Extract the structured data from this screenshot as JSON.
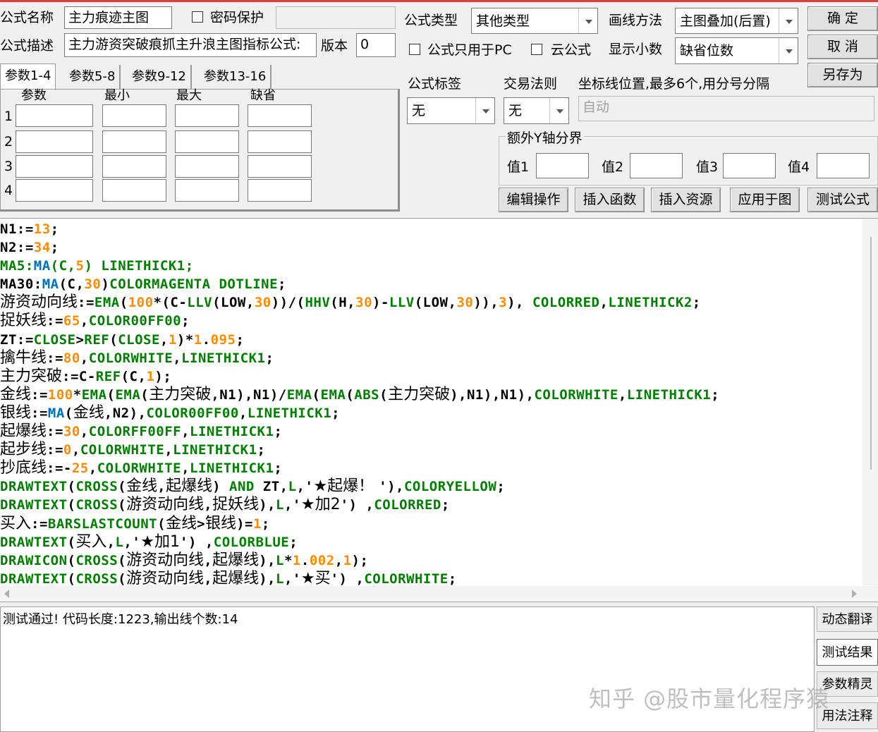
{
  "header": {
    "formula_name_label": "公式名称",
    "formula_name_value": "主力痕迹主图",
    "password_label": "密码保护",
    "formula_desc_label": "公式描述",
    "formula_desc_value": "主力游资突破痕抓主升浪主图指标公式:",
    "version_label": "版本",
    "version_value": "0",
    "formula_type_label": "公式类型",
    "formula_type_value": "其他类型",
    "draw_method_label": "画线方法",
    "draw_method_value": "主图叠加(后置)",
    "pc_only_label": "公式只用于PC",
    "cloud_label": "云公式",
    "show_decimal_label": "显示小数",
    "show_decimal_value": "缺省位数"
  },
  "buttons": {
    "ok": "确 定",
    "cancel": "取 消",
    "save_as": "另存为"
  },
  "tabs": [
    "参数1-4",
    "参数5-8",
    "参数9-12",
    "参数13-16"
  ],
  "params": {
    "col_param": "参数",
    "col_min": "最小",
    "col_max": "最大",
    "col_default": "缺省",
    "rows": [
      "1",
      "2",
      "3",
      "4"
    ]
  },
  "options": {
    "tag_label": "公式标签",
    "tag_value": "无",
    "trade_rule_label": "交易法则",
    "trade_rule_value": "无",
    "axis_label": "坐标线位置,最多6个,用分号分隔",
    "axis_placeholder": "自动",
    "extra_y_label": "额外Y轴分界",
    "val1": "值1",
    "val2": "值2",
    "val3": "值3",
    "val4": "值4"
  },
  "actions": {
    "edit": "编辑操作",
    "insert_func": "插入函数",
    "insert_res": "插入资源",
    "apply": "应用于图",
    "test": "测试公式"
  },
  "colors": {
    "keyword": "#008000",
    "function": "#0070c0",
    "number": "#ff8c00",
    "title_bar": "#d9403a"
  },
  "code_lines": [
    [
      [
        "k",
        "N1:="
      ],
      [
        "o",
        "13"
      ],
      [
        "k",
        ";"
      ]
    ],
    [
      [
        "k",
        "N2:="
      ],
      [
        "o",
        "34"
      ],
      [
        "k",
        ";"
      ]
    ],
    [
      [
        "g",
        "MA5:"
      ],
      [
        "b",
        "MA"
      ],
      [
        "g",
        "(C,"
      ],
      [
        "o",
        "5"
      ],
      [
        "g",
        ") LINETHICK1;"
      ]
    ],
    [
      [
        "k",
        "MA30:"
      ],
      [
        "b",
        "MA"
      ],
      [
        "k",
        "(C,"
      ],
      [
        "o",
        "30"
      ],
      [
        "k",
        ")"
      ],
      [
        "g",
        "COLORMAGENTA DOTLINE"
      ],
      [
        "k",
        ";"
      ]
    ],
    [
      [
        "cn",
        "游资动向线"
      ],
      [
        "k",
        ":="
      ],
      [
        "g",
        "EMA"
      ],
      [
        "k",
        "("
      ],
      [
        "o",
        "100"
      ],
      [
        "k",
        "*(C-"
      ],
      [
        "g",
        "LLV"
      ],
      [
        "k",
        "(LOW,"
      ],
      [
        "o",
        "30"
      ],
      [
        "k",
        "))/("
      ],
      [
        "g",
        "HHV"
      ],
      [
        "k",
        "(H,"
      ],
      [
        "o",
        "30"
      ],
      [
        "k",
        ")-"
      ],
      [
        "g",
        "LLV"
      ],
      [
        "k",
        "(LOW,"
      ],
      [
        "o",
        "30"
      ],
      [
        "k",
        ")),"
      ],
      [
        "o",
        "3"
      ],
      [
        "k",
        "), "
      ],
      [
        "g",
        "COLORRED"
      ],
      [
        "k",
        ","
      ],
      [
        "g",
        "LINETHICK2"
      ],
      [
        "k",
        ";"
      ]
    ],
    [
      [
        "cn",
        "捉妖线"
      ],
      [
        "k",
        ":="
      ],
      [
        "o",
        "65"
      ],
      [
        "k",
        ","
      ],
      [
        "g",
        "COLOR00FF00"
      ],
      [
        "k",
        ";"
      ]
    ],
    [
      [
        "k",
        "ZT:="
      ],
      [
        "g",
        "CLOSE"
      ],
      [
        "k",
        ">"
      ],
      [
        "g",
        "REF"
      ],
      [
        "k",
        "("
      ],
      [
        "g",
        "CLOSE"
      ],
      [
        "k",
        ","
      ],
      [
        "o",
        "1"
      ],
      [
        "k",
        ")*"
      ],
      [
        "o",
        "1"
      ],
      [
        "k",
        "."
      ],
      [
        "o",
        "095"
      ],
      [
        "k",
        ";"
      ]
    ],
    [
      [
        "cn",
        "擒牛线"
      ],
      [
        "k",
        ":="
      ],
      [
        "o",
        "80"
      ],
      [
        "k",
        ","
      ],
      [
        "g",
        "COLORWHITE"
      ],
      [
        "k",
        ","
      ],
      [
        "g",
        "LINETHICK1"
      ],
      [
        "k",
        ";"
      ]
    ],
    [
      [
        "cn",
        "主力突破"
      ],
      [
        "k",
        ":=C-"
      ],
      [
        "g",
        "REF"
      ],
      [
        "k",
        "(C,"
      ],
      [
        "o",
        "1"
      ],
      [
        "k",
        ");"
      ]
    ],
    [
      [
        "cn",
        "金线"
      ],
      [
        "k",
        ":="
      ],
      [
        "o",
        "100"
      ],
      [
        "k",
        "*"
      ],
      [
        "g",
        "EMA"
      ],
      [
        "k",
        "("
      ],
      [
        "g",
        "EMA"
      ],
      [
        "k",
        "("
      ],
      [
        "cn",
        "主力突破"
      ],
      [
        "k",
        ",N1),N1)/"
      ],
      [
        "g",
        "EMA"
      ],
      [
        "k",
        "("
      ],
      [
        "g",
        "EMA"
      ],
      [
        "k",
        "("
      ],
      [
        "g",
        "ABS"
      ],
      [
        "k",
        "("
      ],
      [
        "cn",
        "主力突破"
      ],
      [
        "k",
        "),N1),N1),"
      ],
      [
        "g",
        "COLORWHITE"
      ],
      [
        "k",
        ","
      ],
      [
        "g",
        "LINETHICK1"
      ],
      [
        "k",
        ";"
      ]
    ],
    [
      [
        "cn",
        "银线"
      ],
      [
        "k",
        ":="
      ],
      [
        "b",
        "MA"
      ],
      [
        "k",
        "("
      ],
      [
        "cn",
        "金线"
      ],
      [
        "k",
        ",N2),"
      ],
      [
        "g",
        "COLOR00FF00"
      ],
      [
        "k",
        ","
      ],
      [
        "g",
        "LINETHICK1"
      ],
      [
        "k",
        ";"
      ]
    ],
    [
      [
        "cn",
        "起爆线"
      ],
      [
        "k",
        ":="
      ],
      [
        "o",
        "30"
      ],
      [
        "k",
        ","
      ],
      [
        "g",
        "COLORFF00FF"
      ],
      [
        "k",
        ","
      ],
      [
        "g",
        "LINETHICK1"
      ],
      [
        "k",
        ";"
      ]
    ],
    [
      [
        "cn",
        "起步线"
      ],
      [
        "k",
        ":="
      ],
      [
        "o",
        "0"
      ],
      [
        "k",
        ","
      ],
      [
        "g",
        "COLORWHITE"
      ],
      [
        "k",
        ","
      ],
      [
        "g",
        "LINETHICK1"
      ],
      [
        "k",
        ";"
      ]
    ],
    [
      [
        "cn",
        "抄底线"
      ],
      [
        "k",
        ":=-"
      ],
      [
        "o",
        "25"
      ],
      [
        "k",
        ","
      ],
      [
        "g",
        "COLORWHITE"
      ],
      [
        "k",
        ","
      ],
      [
        "g",
        "LINETHICK1"
      ],
      [
        "k",
        ";"
      ]
    ],
    [
      [
        "g",
        "DRAWTEXT"
      ],
      [
        "k",
        "("
      ],
      [
        "g",
        "CROSS"
      ],
      [
        "k",
        "("
      ],
      [
        "cn",
        "金线"
      ],
      [
        "k",
        ","
      ],
      [
        "cn",
        "起爆线"
      ],
      [
        "k",
        ") "
      ],
      [
        "g",
        "AND"
      ],
      [
        "k",
        " ZT,"
      ],
      [
        "g",
        "L"
      ],
      [
        "k",
        ",'"
      ],
      [
        "cn",
        "★起爆！ "
      ],
      [
        "k",
        "'),"
      ],
      [
        "g",
        "COLORYELLOW"
      ],
      [
        "k",
        ";"
      ]
    ],
    [
      [
        "g",
        "DRAWTEXT"
      ],
      [
        "k",
        "("
      ],
      [
        "g",
        "CROSS"
      ],
      [
        "k",
        "("
      ],
      [
        "cn",
        "游资动向线"
      ],
      [
        "k",
        ","
      ],
      [
        "cn",
        "捉妖线"
      ],
      [
        "k",
        "),"
      ],
      [
        "g",
        "L"
      ],
      [
        "k",
        ",'"
      ],
      [
        "cn",
        "★加2"
      ],
      [
        "k",
        "') ,"
      ],
      [
        "g",
        "COLORRED"
      ],
      [
        "k",
        ";"
      ]
    ],
    [
      [
        "cn",
        "买入"
      ],
      [
        "k",
        ":="
      ],
      [
        "g",
        "BARSLASTCOUNT"
      ],
      [
        "k",
        "("
      ],
      [
        "cn",
        "金线"
      ],
      [
        "k",
        ">"
      ],
      [
        "cn",
        "银线"
      ],
      [
        "k",
        ")="
      ],
      [
        "o",
        "1"
      ],
      [
        "k",
        ";"
      ]
    ],
    [
      [
        "g",
        "DRAWTEXT"
      ],
      [
        "k",
        "("
      ],
      [
        "cn",
        "买入"
      ],
      [
        "k",
        ","
      ],
      [
        "g",
        "L"
      ],
      [
        "k",
        ",'"
      ],
      [
        "cn",
        "★加1"
      ],
      [
        "k",
        "') ,"
      ],
      [
        "g",
        "COLORBLUE"
      ],
      [
        "k",
        ";"
      ]
    ],
    [
      [
        "g",
        "DRAWICON"
      ],
      [
        "k",
        "("
      ],
      [
        "g",
        "CROSS"
      ],
      [
        "k",
        "("
      ],
      [
        "cn",
        "游资动向线"
      ],
      [
        "k",
        ","
      ],
      [
        "cn",
        "起爆线"
      ],
      [
        "k",
        "),"
      ],
      [
        "g",
        "L"
      ],
      [
        "k",
        "*"
      ],
      [
        "o",
        "1"
      ],
      [
        "k",
        "."
      ],
      [
        "o",
        "002"
      ],
      [
        "k",
        ","
      ],
      [
        "o",
        "1"
      ],
      [
        "k",
        ");"
      ]
    ],
    [
      [
        "g",
        "DRAWTEXT"
      ],
      [
        "k",
        "("
      ],
      [
        "g",
        "CROSS"
      ],
      [
        "k",
        "("
      ],
      [
        "cn",
        "游资动向线"
      ],
      [
        "k",
        ","
      ],
      [
        "cn",
        "起爆线"
      ],
      [
        "k",
        "),"
      ],
      [
        "g",
        "L"
      ],
      [
        "k",
        ",'"
      ],
      [
        "cn",
        "★买"
      ],
      [
        "k",
        "') ,"
      ],
      [
        "g",
        "COLORWHITE"
      ],
      [
        "k",
        ";"
      ]
    ]
  ],
  "result": {
    "text": "测试通过! 代码长度:1223,输出线个数:14"
  },
  "side_buttons": {
    "translate": "动态翻译",
    "test_result": "测试结果",
    "param_wizard": "参数精灵",
    "usage_note": "用法注释"
  },
  "watermark": "知乎 @股市量化程序猿"
}
